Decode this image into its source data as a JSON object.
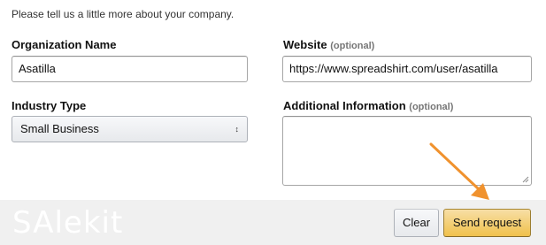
{
  "intro_text": "Please tell us a little more about your company.",
  "organization": {
    "label": "Organization Name",
    "value": "Asatilla"
  },
  "website": {
    "label": "Website",
    "optional": "(optional)",
    "value": "https://www.spreadshirt.com/user/asatilla"
  },
  "industry": {
    "label": "Industry Type",
    "selected": "Small Business",
    "caret": "↕"
  },
  "additional": {
    "label": "Additional Information",
    "optional": "(optional)",
    "value": ""
  },
  "buttons": {
    "clear": "Clear",
    "send": "Send request"
  },
  "watermark": "SAlekit",
  "colors": {
    "arrow": "#f0922e",
    "send_button": "#f0c14b"
  }
}
